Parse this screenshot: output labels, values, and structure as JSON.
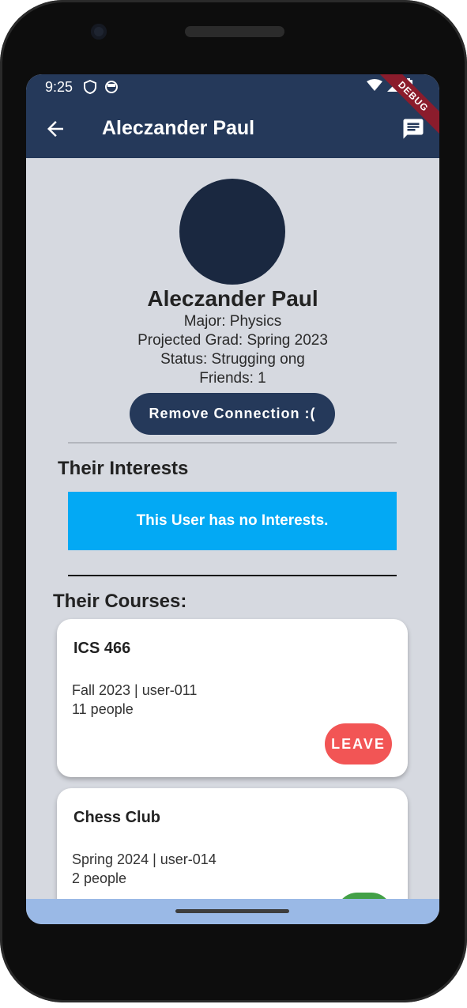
{
  "status_bar": {
    "time": "9:25",
    "left_icons": [
      "shield-icon",
      "sync-icon"
    ],
    "right_icons": [
      "wifi-icon",
      "signal-icon",
      "battery-icon"
    ],
    "debug_label": "DEBUG"
  },
  "app_bar": {
    "title": "Aleczander Paul",
    "back_icon": "arrow-back-icon",
    "action_icon": "chat-icon"
  },
  "profile": {
    "name": "Aleczander Paul",
    "major": "Major: Physics",
    "grad": "Projected Grad: Spring 2023",
    "status": "Status: Strugging ong",
    "friends": "Friends: 1",
    "remove_button": "Remove Connection :("
  },
  "interests": {
    "title": "Their Interests",
    "empty_message": "This User has no Interests."
  },
  "courses": {
    "title": "Their Courses:",
    "items": [
      {
        "name": "ICS 466",
        "term": "Fall 2023 | user-011",
        "people": "11 people",
        "action": "LEAVE"
      },
      {
        "name": "Chess Club",
        "term": "Spring 2024 | user-014",
        "people": "2 people",
        "action": ""
      }
    ]
  },
  "colors": {
    "app_bar": "#25395a",
    "background": "#d6d9e0",
    "interests_box": "#03a9f4",
    "leave_button": "#f25555",
    "join_button": "#43a047"
  }
}
